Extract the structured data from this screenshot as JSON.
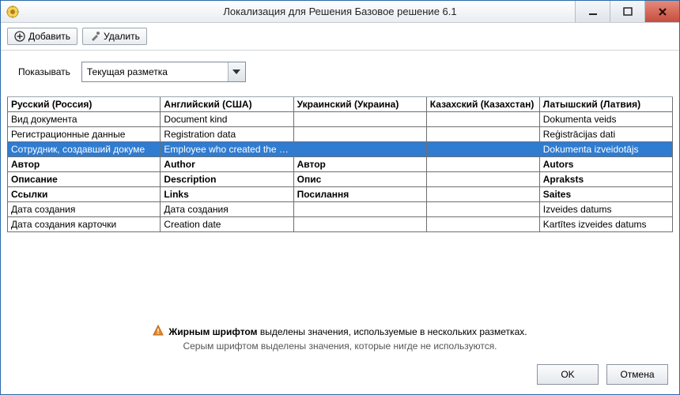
{
  "window": {
    "title": "Локализация для Решения Базовое решение 6.1"
  },
  "toolbar": {
    "add": "Добавить",
    "delete": "Удалить"
  },
  "filter": {
    "label": "Показывать",
    "selected": "Текущая разметка"
  },
  "grid": {
    "headers": {
      "ru": "Русский (Россия)",
      "en": "Английский (США)",
      "uk": "Украинский (Украина)",
      "kk": "Казахский (Казахстан)",
      "lv": "Латышский (Латвия)"
    },
    "rows": [
      {
        "bold": false,
        "selected": false,
        "ru": "Вид документа",
        "en": "Document kind",
        "uk": "",
        "kk": "",
        "lv": "Dokumenta veids"
      },
      {
        "bold": false,
        "selected": false,
        "ru": "Регистрационные данные",
        "en": "Registration data",
        "uk": "",
        "kk": "",
        "lv": "Reģistrācijas dati"
      },
      {
        "bold": false,
        "selected": true,
        "ru": "Сотрудник, создавший докуме",
        "en": "Employee who created the doc",
        "uk": "",
        "kk": "",
        "lv": "Dokumenta izveidotājs"
      },
      {
        "bold": true,
        "selected": false,
        "ru": "Автор",
        "en": "Author",
        "uk": "Автор",
        "kk": "",
        "lv": "Autors"
      },
      {
        "bold": true,
        "selected": false,
        "ru": "Описание",
        "en": "Description",
        "uk": "Опис",
        "kk": "",
        "lv": "Apraksts"
      },
      {
        "bold": true,
        "selected": false,
        "ru": "Ссылки",
        "en": "Links",
        "uk": "Посилання",
        "kk": "",
        "lv": "Saites"
      },
      {
        "bold": false,
        "selected": false,
        "ru": "Дата создания",
        "en": "Дата создания",
        "uk": "",
        "kk": "",
        "lv": "Izveides datums"
      },
      {
        "bold": false,
        "selected": false,
        "ru": "Дата создания карточки",
        "en": "Creation date",
        "uk": "",
        "kk": "",
        "lv": "Kartītes izveides datums"
      }
    ]
  },
  "footer": {
    "line1_bold": "Жирным шрифтом",
    "line1_rest": " выделены значения, используемые в нескольких разметках.",
    "line2": "Серым шрифтом выделены значения, которые нигде не используются."
  },
  "buttons": {
    "ok": "OK",
    "cancel": "Отмена"
  }
}
